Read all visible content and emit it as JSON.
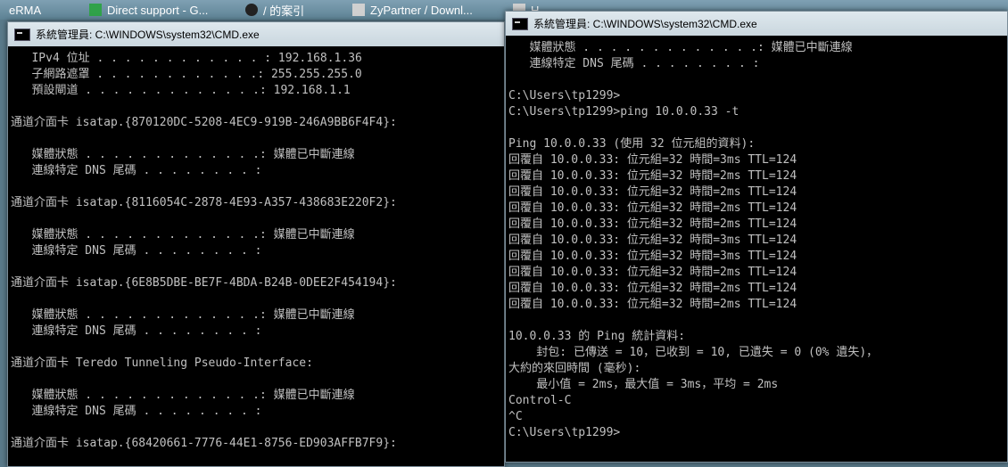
{
  "taskbar": {
    "items": [
      {
        "label": "eRMA",
        "icon": "app-icon",
        "color": "#f5f5f5"
      },
      {
        "label": "Direct support - G...",
        "icon": "support-icon",
        "color": "#30a24a"
      },
      {
        "label": "/ 的案引",
        "icon": "browser-icon",
        "color": "#222222"
      },
      {
        "label": "ZyPartner / Downl...",
        "icon": "zyxel-icon",
        "color": "#d0d0d0"
      },
      {
        "label": "H",
        "icon": "app-icon",
        "color": "#d0d0d0"
      }
    ]
  },
  "left_window": {
    "title": "系統管理員: C:\\WINDOWS\\system32\\CMD.exe",
    "lines": [
      "   IPv4 位址 . . . . . . . . . . . . : 192.168.1.36",
      "   子網路遮罩 . . . . . . . . . . . .: 255.255.255.0",
      "   預設閘道 . . . . . . . . . . . . .: 192.168.1.1",
      "",
      "通道介面卡 isatap.{870120DC-5208-4EC9-919B-246A9BB6F4F4}:",
      "",
      "   媒體狀態 . . . . . . . . . . . . .: 媒體已中斷連線",
      "   連線特定 DNS 尾碼 . . . . . . . . :",
      "",
      "通道介面卡 isatap.{8116054C-2878-4E93-A357-438683E220F2}:",
      "",
      "   媒體狀態 . . . . . . . . . . . . .: 媒體已中斷連線",
      "   連線特定 DNS 尾碼 . . . . . . . . :",
      "",
      "通道介面卡 isatap.{6E8B5DBE-BE7F-4BDA-B24B-0DEE2F454194}:",
      "",
      "   媒體狀態 . . . . . . . . . . . . .: 媒體已中斷連線",
      "   連線特定 DNS 尾碼 . . . . . . . . :",
      "",
      "通道介面卡 Teredo Tunneling Pseudo-Interface:",
      "",
      "   媒體狀態 . . . . . . . . . . . . .: 媒體已中斷連線",
      "   連線特定 DNS 尾碼 . . . . . . . . :",
      "",
      "通道介面卡 isatap.{68420661-7776-44E1-8756-ED903AFFB7F9}:"
    ]
  },
  "right_window": {
    "title": "系統管理員: C:\\WINDOWS\\system32\\CMD.exe",
    "lines": [
      "   媒體狀態 . . . . . . . . . . . . .: 媒體已中斷連線",
      "   連線特定 DNS 尾碼 . . . . . . . . :",
      "",
      "C:\\Users\\tp1299>",
      "C:\\Users\\tp1299>ping 10.0.0.33 -t",
      "",
      "Ping 10.0.0.33 (使用 32 位元組的資料):",
      "回覆自 10.0.0.33: 位元組=32 時間=3ms TTL=124",
      "回覆自 10.0.0.33: 位元組=32 時間=2ms TTL=124",
      "回覆自 10.0.0.33: 位元組=32 時間=2ms TTL=124",
      "回覆自 10.0.0.33: 位元組=32 時間=2ms TTL=124",
      "回覆自 10.0.0.33: 位元組=32 時間=2ms TTL=124",
      "回覆自 10.0.0.33: 位元組=32 時間=3ms TTL=124",
      "回覆自 10.0.0.33: 位元組=32 時間=3ms TTL=124",
      "回覆自 10.0.0.33: 位元組=32 時間=2ms TTL=124",
      "回覆自 10.0.0.33: 位元組=32 時間=2ms TTL=124",
      "回覆自 10.0.0.33: 位元組=32 時間=2ms TTL=124",
      "",
      "10.0.0.33 的 Ping 統計資料:",
      "    封包: 已傳送 = 10，已收到 = 10, 已遺失 = 0 (0% 遺失)，",
      "大約的來回時間 (毫秒):",
      "    最小值 = 2ms，最大值 = 3ms，平均 = 2ms",
      "Control-C",
      "^C",
      "C:\\Users\\tp1299>"
    ]
  }
}
